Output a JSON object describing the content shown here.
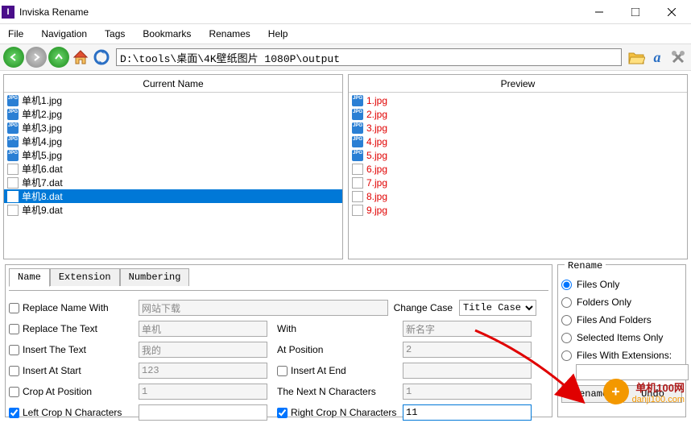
{
  "window": {
    "title": "Inviska Rename",
    "icon_letter": "I"
  },
  "menu": [
    "File",
    "Navigation",
    "Tags",
    "Bookmarks",
    "Renames",
    "Help"
  ],
  "path": "D:\\tools\\桌面\\4K壁纸图片 1080P\\output",
  "panes": {
    "left_header": "Current Name",
    "right_header": "Preview",
    "left": [
      {
        "name": "单机1.jpg",
        "icon": "jpg"
      },
      {
        "name": "单机2.jpg",
        "icon": "jpg"
      },
      {
        "name": "单机3.jpg",
        "icon": "jpg"
      },
      {
        "name": "单机4.jpg",
        "icon": "jpg"
      },
      {
        "name": "单机5.jpg",
        "icon": "jpg"
      },
      {
        "name": "单机6.dat",
        "icon": "dat"
      },
      {
        "name": "单机7.dat",
        "icon": "dat"
      },
      {
        "name": "单机8.dat",
        "icon": "dat",
        "selected": true
      },
      {
        "name": "单机9.dat",
        "icon": "dat"
      }
    ],
    "right": [
      {
        "name": "1.jpg",
        "icon": "jpg"
      },
      {
        "name": "2.jpg",
        "icon": "jpg"
      },
      {
        "name": "3.jpg",
        "icon": "jpg"
      },
      {
        "name": "4.jpg",
        "icon": "jpg"
      },
      {
        "name": "5.jpg",
        "icon": "jpg"
      },
      {
        "name": "6.jpg",
        "icon": "dat"
      },
      {
        "name": "7.jpg",
        "icon": "dat"
      },
      {
        "name": "8.jpg",
        "icon": "dat"
      },
      {
        "name": "9.jpg",
        "icon": "dat"
      }
    ]
  },
  "tabs": [
    "Name",
    "Extension",
    "Numbering"
  ],
  "form": {
    "replace_name_with": {
      "label": "Replace Name With",
      "value": "网站下载",
      "checked": false
    },
    "change_case": {
      "label": "Change Case",
      "value": "Title Case"
    },
    "replace_text": {
      "label": "Replace The Text",
      "value": "单机",
      "with_label": "With",
      "with_value": "新名字",
      "checked": false
    },
    "insert_text": {
      "label": "Insert The Text",
      "value": "我的",
      "at_label": "At Position",
      "at_value": "2",
      "checked": false
    },
    "insert_start": {
      "label": "Insert At Start",
      "value": "123",
      "end_label": "Insert At End",
      "end_value": "",
      "checked": false,
      "end_checked": false
    },
    "crop_at": {
      "label": "Crop At Position",
      "value": "1",
      "next_label": "The Next N Characters",
      "next_value": "1",
      "checked": false
    },
    "left_crop": {
      "label": "Left Crop N Characters",
      "value": "",
      "right_label": "Right Crop N Characters",
      "right_value": "11",
      "checked": true,
      "right_checked": true
    }
  },
  "rename": {
    "legend": "Rename",
    "options": [
      "Files Only",
      "Folders Only",
      "Files And Folders",
      "Selected Items Only",
      "Files With Extensions:"
    ],
    "selected": 0,
    "ext_value": "",
    "rename_btn": "Rename",
    "undo_btn": "Undo"
  },
  "watermark": {
    "tag": "+",
    "text1": "单机100网",
    "text2": "danji100.com"
  }
}
